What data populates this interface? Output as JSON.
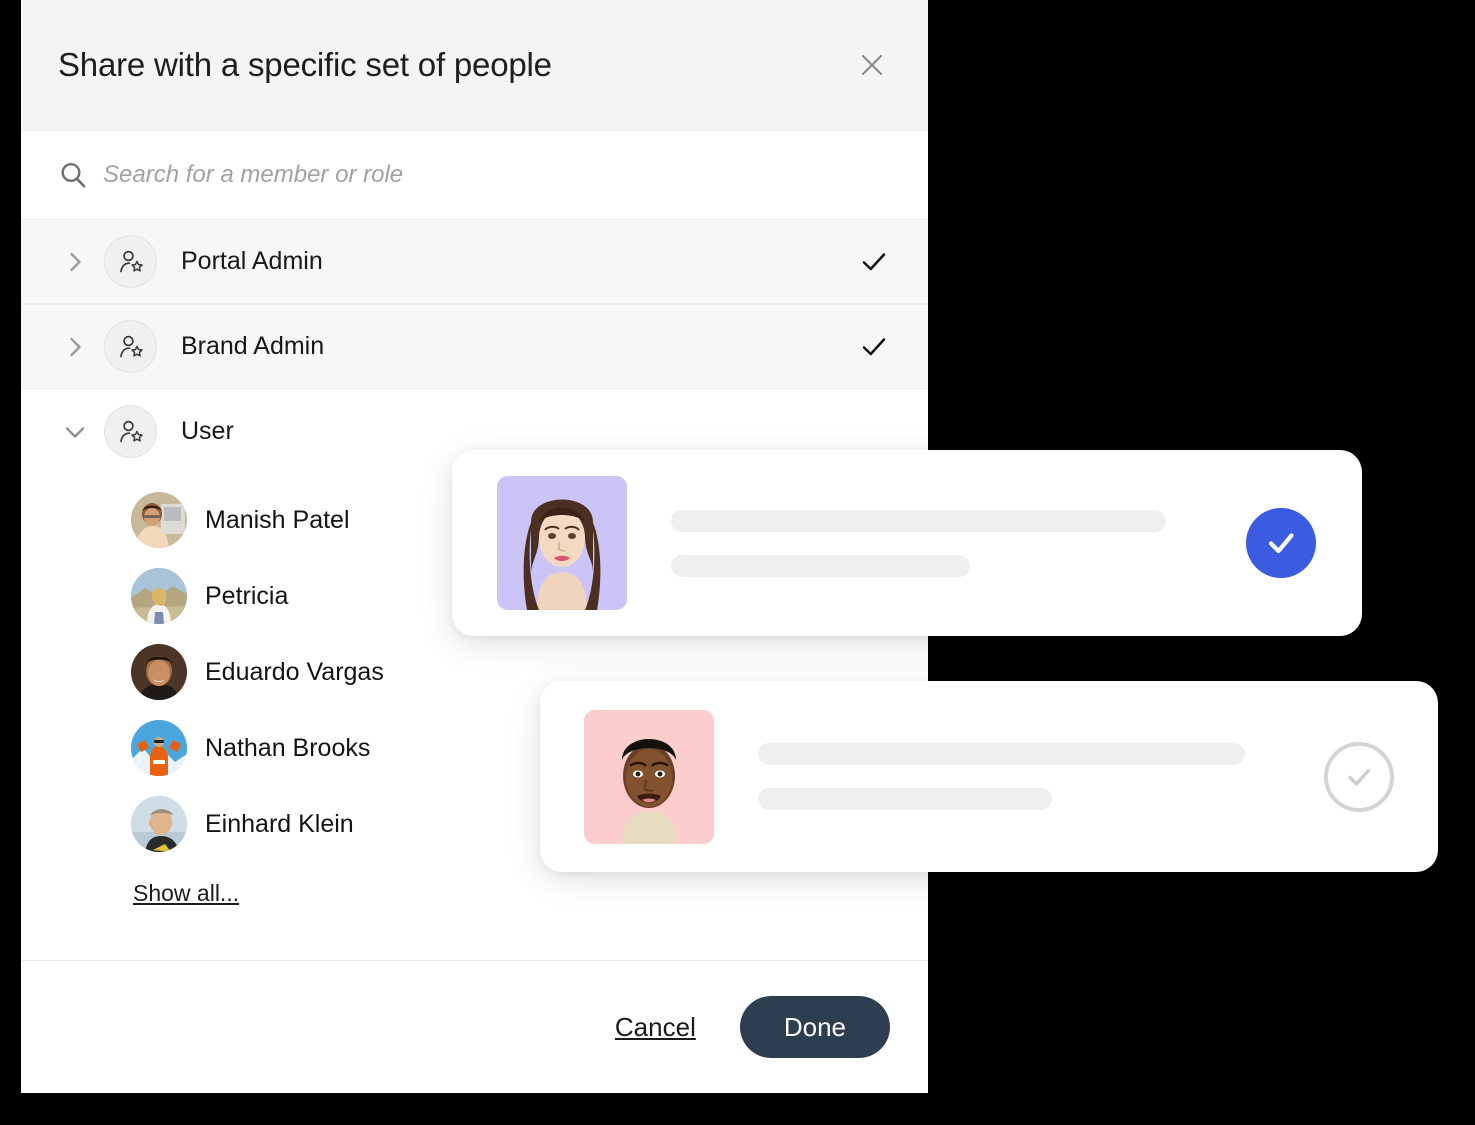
{
  "dialog": {
    "title": "Share with a specific set of people",
    "close_icon": "close-icon"
  },
  "search": {
    "icon": "search-icon",
    "value": "",
    "placeholder": "Search for a member or role"
  },
  "roles": [
    {
      "label": "Portal Admin",
      "expanded": false,
      "chevron_icon": "chevron-right-icon",
      "avatar_icon": "person-star-icon",
      "selected": true,
      "check_icon": "checkmark-icon"
    },
    {
      "label": "Brand Admin",
      "expanded": false,
      "chevron_icon": "chevron-right-icon",
      "avatar_icon": "person-star-icon",
      "selected": true,
      "check_icon": "checkmark-icon"
    },
    {
      "label": "User",
      "expanded": true,
      "chevron_icon": "chevron-down-icon",
      "avatar_icon": "person-star-icon",
      "selected": false,
      "check_icon": ""
    }
  ],
  "members": [
    {
      "name": "Manish Patel",
      "avatar": "photo-avatar-manish"
    },
    {
      "name": "Petricia",
      "avatar": "photo-avatar-petricia"
    },
    {
      "name": "Eduardo Vargas",
      "avatar": "photo-avatar-eduardo"
    },
    {
      "name": "Nathan Brooks",
      "avatar": "photo-avatar-nathan"
    },
    {
      "name": "Einhard Klein",
      "avatar": "photo-avatar-einhard"
    }
  ],
  "show_all": {
    "label": "Show all..."
  },
  "footer": {
    "cancel_label": "Cancel",
    "done_label": "Done"
  },
  "floating_cards": [
    {
      "photo_background": "#ccc4f7",
      "photo_name": "woman-portrait-photo",
      "selected": true,
      "check_icon": "check-circle-filled-icon",
      "check_color": "#3b5ce0"
    },
    {
      "photo_background": "#fbcdcd",
      "photo_name": "man-portrait-photo",
      "selected": false,
      "check_icon": "check-circle-outline-icon",
      "check_color": "#d4d4d4"
    }
  ],
  "colors": {
    "page_background": "#000000",
    "panel_background": "#ffffff",
    "header_background": "#f4f4f4",
    "row_shaded": "#f7f7f7",
    "accent_blue": "#3b5ce0",
    "done_button": "#2c3e50",
    "skeleton_gray": "#efefef"
  }
}
